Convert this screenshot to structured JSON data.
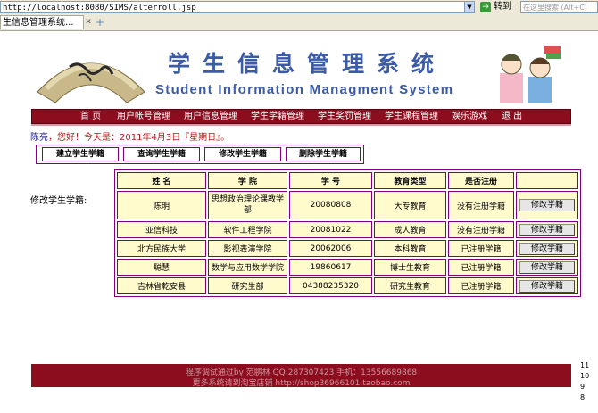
{
  "browser": {
    "url": "http://localhost:8080/SIMS/alterroll.jsp",
    "go_label": "转到",
    "search_placeholder": "在这里搜索 (Alt+C)",
    "tab_title": "生信息管理系统..."
  },
  "banner": {
    "title_cn": "学生信息管理系统",
    "title_en": "Student Information Managment System"
  },
  "nav": {
    "items": [
      "首 页",
      "用户帐号管理",
      "用户信息管理",
      "学生学籍管理",
      "学生奖罚管理",
      "学生课程管理",
      "娱乐游戏",
      "退 出"
    ]
  },
  "greeting": {
    "user": "陈亮",
    "text": "，您好！今天是：2011年4月3日『星期日』。"
  },
  "actions": [
    "建立学生学籍",
    "查询学生学籍",
    "修改学生学籍",
    "删除学生学籍"
  ],
  "side_label": "修改学生学籍:",
  "table": {
    "headers": [
      "姓  名",
      "学  院",
      "学  号",
      "教育类型",
      "是否注册",
      ""
    ],
    "button_label": "修改学籍",
    "rows": [
      {
        "name": "陈明",
        "college": "思想政治理论课教学部",
        "id": "20080808",
        "edu": "大专教育",
        "reg": "没有注册学籍"
      },
      {
        "name": "亚信科技",
        "college": "软件工程学院",
        "id": "20081022",
        "edu": "成人教育",
        "reg": "没有注册学籍"
      },
      {
        "name": "北方民族大学",
        "college": "影视表演学院",
        "id": "20062006",
        "edu": "本科教育",
        "reg": "已注册学籍"
      },
      {
        "name": "聪慧",
        "college": "数学与应用数学学院",
        "id": "19860617",
        "edu": "博士生教育",
        "reg": "已注册学籍"
      },
      {
        "name": "吉林省乾安县",
        "college": "研究生部",
        "id": "04388235320",
        "edu": "研究生教育",
        "reg": "已注册学籍"
      }
    ]
  },
  "footer": {
    "line1": "程序调试通过by 范鹏林 QQ:287307423 手机：13556689868",
    "line2": "更多系统请到淘宝店铺 http://shop36966101.taobao.com"
  },
  "scale_marks": [
    "11",
    "10",
    "9",
    "8"
  ],
  "colors": {
    "nav_bg": "#8b0d1e",
    "title_blue": "#3b5aa8",
    "table_border": "#800080",
    "cell_bg": "#fffbcc"
  }
}
